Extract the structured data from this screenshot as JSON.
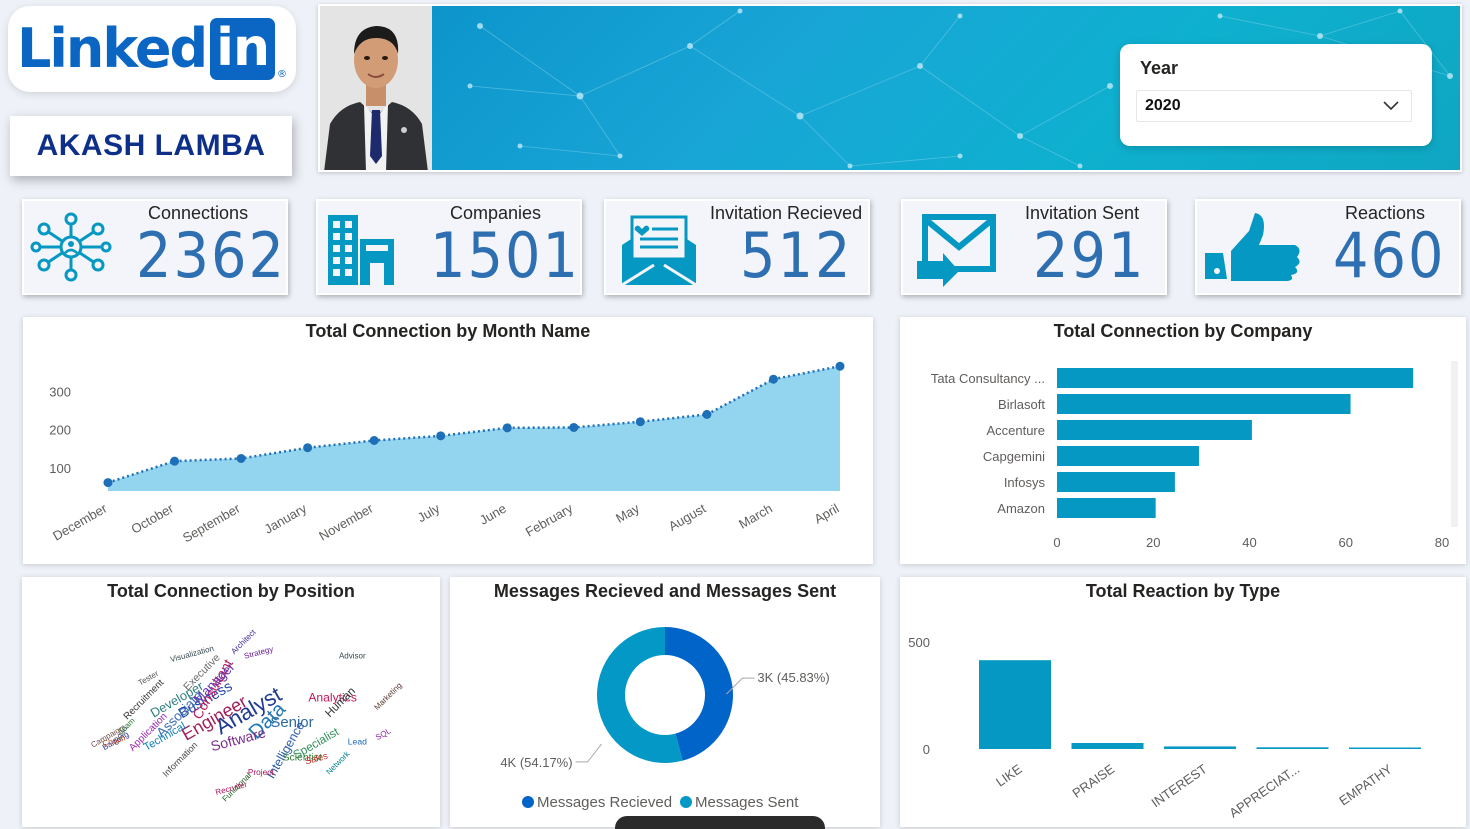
{
  "logo": {
    "text": "Linked",
    "box": "in",
    "reg": "®"
  },
  "profile": {
    "name": "AKASH LAMBA"
  },
  "filter": {
    "label": "Year",
    "selected": "2020"
  },
  "kpis": [
    {
      "label": "Connections",
      "value": "2362",
      "icon": "network-icon"
    },
    {
      "label": "Companies",
      "value": "1501",
      "icon": "building-icon"
    },
    {
      "label": "Invitation Recieved",
      "value": "512",
      "icon": "envelope-open-icon"
    },
    {
      "label": "Invitation Sent",
      "value": "291",
      "icon": "envelope-send-icon"
    },
    {
      "label": "Reactions",
      "value": "460",
      "icon": "thumbs-up-icon"
    }
  ],
  "colors": {
    "brand": "#0a66c2",
    "accent": "#0096c7",
    "bar": "#0598c2",
    "kpi_value": "#2e6fb2",
    "donut_received": "#0064c8",
    "donut_sent": "#0498c6"
  },
  "chart_data": [
    {
      "type": "area",
      "title": "Total Connection by Month Name",
      "categories": [
        "December",
        "October",
        "September",
        "January",
        "November",
        "July",
        "June",
        "February",
        "May",
        "August",
        "March",
        "April"
      ],
      "values": [
        62,
        118,
        125,
        153,
        172,
        184,
        205,
        206,
        221,
        240,
        332,
        366
      ],
      "yticks": [
        "100",
        "200",
        "300"
      ],
      "ylim": [
        40,
        390
      ]
    },
    {
      "type": "bar",
      "orientation": "horizontal",
      "title": "Total Connection by Company",
      "categories": [
        "Tata Consultancy ...",
        "Birlasoft",
        "Accenture",
        "Capgemini",
        "Infosys",
        "Amazon"
      ],
      "values": [
        74,
        61,
        40.5,
        29.5,
        24.5,
        20.5
      ],
      "xticks": [
        "0",
        "20",
        "40",
        "60",
        "80"
      ],
      "xlim": [
        0,
        80
      ]
    },
    {
      "type": "pie",
      "subtype": "donut",
      "title": "Messages Recieved and Messages Sent",
      "series": [
        {
          "name": "Messages Recieved",
          "value": 45.83,
          "label": "3K (45.83%)"
        },
        {
          "name": "Messages Sent",
          "value": 54.17,
          "label": "4K (54.17%)"
        }
      ]
    },
    {
      "type": "bar",
      "title": "Total Reaction by Type",
      "categories": [
        "LIKE",
        "PRAISE",
        "INTEREST",
        "APPRECIAT...",
        "EMPATHY"
      ],
      "values": [
        415,
        28,
        12,
        8,
        6
      ],
      "yticks": [
        "0",
        "500"
      ],
      "ylim": [
        0,
        500
      ]
    }
  ],
  "wordcloud": {
    "title": "Total Connection by Position",
    "words": [
      {
        "t": "Analyst",
        "c": "#1f3a93"
      },
      {
        "t": "Data",
        "c": "#1f77b4"
      },
      {
        "t": "Engineer",
        "c": "#a31f5a"
      },
      {
        "t": "Senior",
        "c": "#2d6a9f"
      },
      {
        "t": "Business",
        "c": "#2348a6"
      },
      {
        "t": "Software",
        "c": "#7a2c8c"
      },
      {
        "t": "Consultant",
        "c": "#c2185b"
      },
      {
        "t": "Associate",
        "c": "#3d6db5"
      },
      {
        "t": "Manager",
        "c": "#5e35b1"
      },
      {
        "t": "Developer",
        "c": "#2e7d7d"
      },
      {
        "t": "Intelligence",
        "c": "#2a5aa8"
      },
      {
        "t": "Analytics",
        "c": "#c2185b"
      },
      {
        "t": "Specialist",
        "c": "#2f8f5a"
      },
      {
        "t": "Human",
        "c": "#333333"
      },
      {
        "t": "Technical",
        "c": "#0e7fb0"
      },
      {
        "t": "Executive",
        "c": "#6b6b6b"
      },
      {
        "t": "Scientist",
        "c": "#2e7d32"
      },
      {
        "t": "Application",
        "c": "#9c27b0"
      },
      {
        "t": "Recruitment",
        "c": "#333333"
      },
      {
        "t": "Sales",
        "c": "#c62828"
      },
      {
        "t": "Information",
        "c": "#444444"
      },
      {
        "t": "Lead",
        "c": "#1565c0"
      },
      {
        "t": "Project",
        "c": "#ad1457"
      },
      {
        "t": "Team",
        "c": "#2e7d32"
      },
      {
        "t": "Tester",
        "c": "#555555"
      },
      {
        "t": "Strategy",
        "c": "#6a1b9a"
      },
      {
        "t": "Network",
        "c": "#00838f"
      },
      {
        "t": "Cloud",
        "c": "#455a64"
      },
      {
        "t": "SQL",
        "c": "#8e24aa"
      },
      {
        "t": "Visualization",
        "c": "#37474f"
      },
      {
        "t": "Marketing",
        "c": "#5d4037"
      },
      {
        "t": "Banking",
        "c": "#283593"
      },
      {
        "t": "Coach",
        "c": "#d84315"
      },
      {
        "t": "Campaign",
        "c": "#6d4c41"
      },
      {
        "t": "Functional",
        "c": "#1b5e20"
      },
      {
        "t": "Architect",
        "c": "#4527a0"
      },
      {
        "t": "Recruiter",
        "c": "#ad1457"
      },
      {
        "t": "Advisor",
        "c": "#37474f"
      }
    ]
  }
}
